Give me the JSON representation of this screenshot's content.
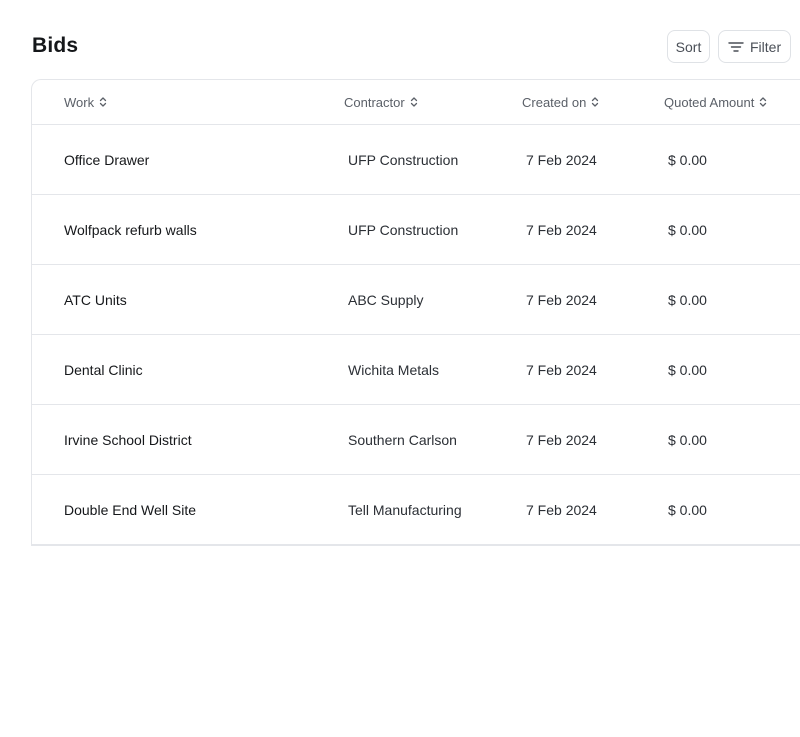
{
  "header": {
    "title": "Bids"
  },
  "toolbar": {
    "sort_label": "Sort",
    "filter_label": "Filter"
  },
  "icons": {
    "sort": "sort-updown-icon",
    "filter": "filter-lines-icon"
  },
  "table": {
    "columns": [
      "Work",
      "Contractor",
      "Created on",
      "Quoted Amount"
    ],
    "rows": [
      {
        "work": "Office Drawer",
        "contractor": "UFP Construction",
        "created": "7 Feb 2024",
        "amount": "$ 0.00"
      },
      {
        "work": "Wolfpack refurb walls",
        "contractor": "UFP Construction",
        "created": "7 Feb 2024",
        "amount": "$ 0.00"
      },
      {
        "work": "ATC Units",
        "contractor": "ABC Supply",
        "created": "7 Feb 2024",
        "amount": "$ 0.00"
      },
      {
        "work": "Dental Clinic",
        "contractor": "Wichita Metals",
        "created": "7 Feb 2024",
        "amount": "$ 0.00"
      },
      {
        "work": "Irvine School District",
        "contractor": "Southern Carlson",
        "created": "7 Feb 2024",
        "amount": "$ 0.00"
      },
      {
        "work": "Double End Well Site",
        "contractor": "Tell Manufacturing",
        "created": "7 Feb 2024",
        "amount": "$ 0.00"
      }
    ]
  }
}
